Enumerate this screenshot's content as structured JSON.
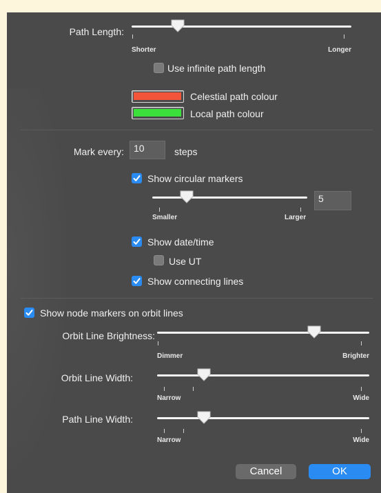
{
  "path_length": {
    "label": "Path Length:",
    "min_label": "Shorter",
    "max_label": "Longer",
    "slider_value": 0.21,
    "infinite_checkbox": {
      "label": "Use infinite path length",
      "checked": false
    }
  },
  "colours": {
    "celestial": {
      "label": "Celestial path colour",
      "color": "#f2553a"
    },
    "local": {
      "label": "Local path colour",
      "color": "#3ce03a"
    }
  },
  "marks": {
    "label": "Mark every:",
    "value": "10",
    "unit": "steps",
    "circular_markers": {
      "label": "Show circular markers",
      "checked": true
    },
    "size_min_label": "Smaller",
    "size_max_label": "Larger",
    "size_slider_value": 0.22,
    "size_value": "5",
    "date_time": {
      "label": "Show date/time",
      "checked": true
    },
    "use_ut": {
      "label": "Use UT",
      "checked": false
    },
    "connecting_lines": {
      "label": "Show connecting lines",
      "checked": true
    }
  },
  "orbit": {
    "node_markers": {
      "label": "Show node markers on orbit lines",
      "checked": true
    },
    "brightness": {
      "label": "Orbit Line Brightness:",
      "min_label": "Dimmer",
      "max_label": "Brighter",
      "slider_value": 0.74
    },
    "width": {
      "label": "Orbit Line Width:",
      "min_label": "Narrow",
      "max_label": "Wide",
      "slider_value": 0.22
    },
    "path_width": {
      "label": "Path Line Width:",
      "min_label": "Narrow",
      "max_label": "Wide",
      "slider_value": 0.22
    }
  },
  "buttons": {
    "cancel": "Cancel",
    "ok": "OK"
  },
  "colors": {
    "accent": "#2a8cf2",
    "panel_bg": "#4a4a4a",
    "page_bg": "#fdf6dc"
  }
}
